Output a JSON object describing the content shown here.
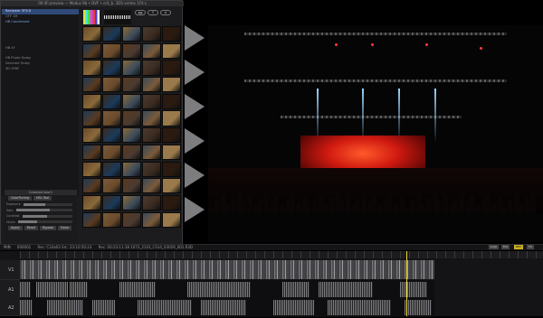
{
  "window": {
    "title": "00:4F:preview — Modus 9b • DVF • crit_b. 3DS vertex 1Fit.s"
  },
  "sidebar": {
    "items": [
      {
        "label": "Reviewer 3F3:D",
        "state": "sel"
      },
      {
        "label": "OFF 1M",
        "state": ""
      },
      {
        "label": "HB Condensed",
        "state": "hi"
      },
      {
        "label": "",
        "state": ""
      },
      {
        "label": "",
        "state": ""
      },
      {
        "label": "",
        "state": ""
      },
      {
        "label": "",
        "state": ""
      },
      {
        "label": "HB 4F",
        "state": ""
      },
      {
        "label": "",
        "state": ""
      },
      {
        "label": "HB Photo Today",
        "state": ""
      },
      {
        "label": "Selected Today",
        "state": ""
      },
      {
        "label": "3D SFBF",
        "state": ""
      },
      {
        "label": "",
        "state": ""
      }
    ]
  },
  "top_controls": {
    "btn1": "◀ ▶",
    "btn2": "☰",
    "btn3": "⚙"
  },
  "thumbnail_count": 60,
  "thumb_colors": [
    "#6a4a2a",
    "#3a2a20",
    "#8a6a3a",
    "#4a3a30",
    "#2a1a10",
    "#1a3a5a",
    "#7a5a3a",
    "#5a3a20",
    "#3a4a5a",
    "#9a7a4a"
  ],
  "color_control": {
    "title": "ColorizeColor1",
    "tabs": [
      "ColorTuning",
      "HSL Tool"
    ],
    "rows": [
      {
        "label": "Exposure",
        "value": 0.45
      },
      {
        "label": "Satn",
        "value": 0.6
      },
      {
        "label": "Contrast",
        "value": 0.5
      },
      {
        "label": "HiLite",
        "value": 0.35
      }
    ],
    "buttons": [
      "Apply",
      "Reset",
      "Bypass",
      "Done"
    ]
  },
  "status": {
    "tc_label": "MIN",
    "tc_value": "000001",
    "rec_a": "Rec: C33a03 Src: 23:10:50:23",
    "rec_b": "Rec: 00:23:11:18 1073_2103_CS14_03029_001.R3D",
    "buttons": [
      "Loop",
      "Full",
      "REV",
      "FX"
    ]
  },
  "tracks": [
    "V1",
    "A1",
    "A2"
  ],
  "colors": {
    "selection": "#2f4a78",
    "playhead": "#e8d23a",
    "stage_red": "#d01a10"
  }
}
